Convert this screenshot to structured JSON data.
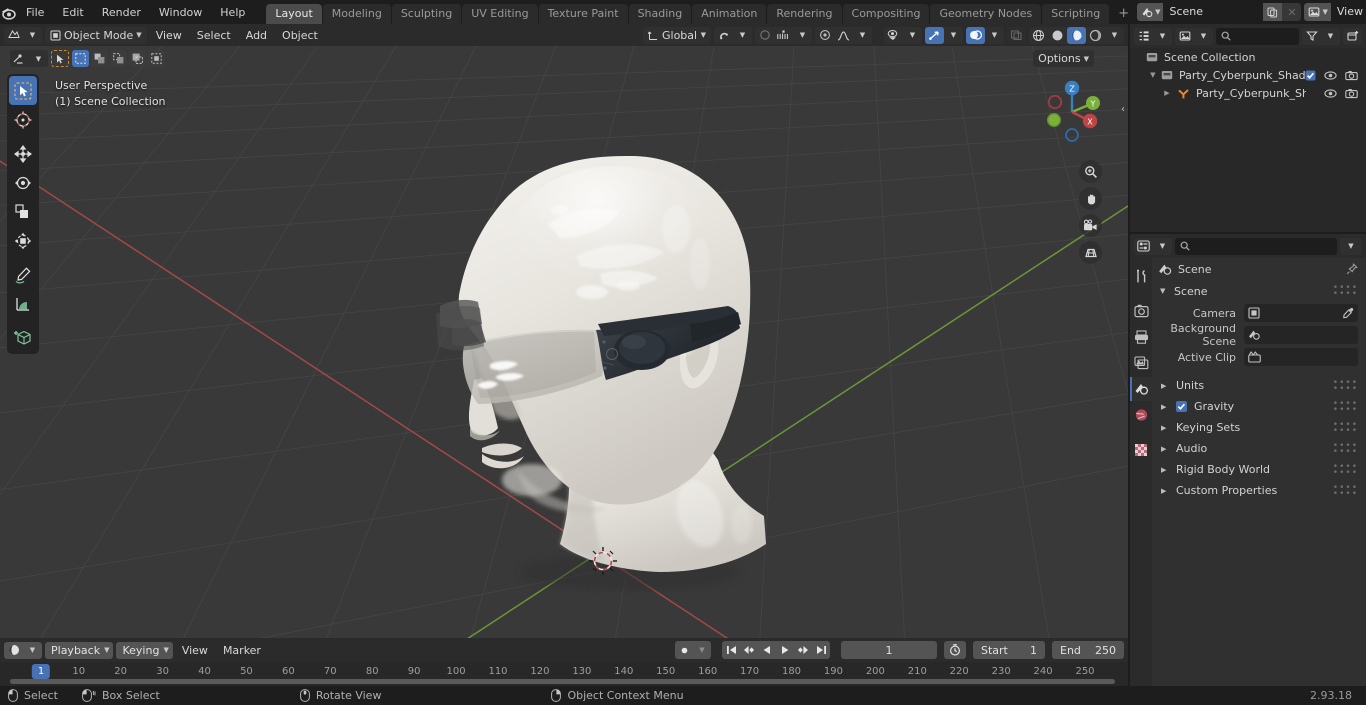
{
  "app": {
    "name": "Blender",
    "version": "2.93.18"
  },
  "topbar": {
    "menus": [
      "File",
      "Edit",
      "Render",
      "Window",
      "Help"
    ],
    "workspaces": [
      {
        "label": "Layout",
        "active": true
      },
      {
        "label": "Modeling",
        "active": false
      },
      {
        "label": "Sculpting",
        "active": false
      },
      {
        "label": "UV Editing",
        "active": false
      },
      {
        "label": "Texture Paint",
        "active": false
      },
      {
        "label": "Shading",
        "active": false
      },
      {
        "label": "Animation",
        "active": false
      },
      {
        "label": "Rendering",
        "active": false
      },
      {
        "label": "Compositing",
        "active": false
      },
      {
        "label": "Geometry Nodes",
        "active": false
      },
      {
        "label": "Scripting",
        "active": false
      }
    ],
    "add_workspace": "+",
    "scene_name": "Scene",
    "view_layer_name": "View Layer"
  },
  "viewport": {
    "mode": "Object Mode",
    "menus": [
      "View",
      "Select",
      "Add",
      "Object"
    ],
    "transform_orientation": "Global",
    "options_label": "Options",
    "overlay_perspective": "User Perspective",
    "overlay_collection": "(1) Scene Collection",
    "gizmo_axes": [
      "X",
      "Y",
      "Z"
    ],
    "tools": [
      "tweak-select-tool",
      "cursor-tool",
      "move-tool",
      "rotate-tool",
      "scale-tool",
      "transform-tool",
      "annotate-tool",
      "measure-tool",
      "add-cube-tool"
    ],
    "nav_buttons": [
      "zoom-icon",
      "pan-hand-icon",
      "camera-view-icon",
      "toggle-ortho-icon"
    ]
  },
  "outliner": {
    "search_placeholder": "",
    "rows": [
      {
        "name": "Scene Collection",
        "indent": 0,
        "icon": "collection-icon",
        "selected": false,
        "disclosure": "",
        "has_toggles": false
      },
      {
        "name": "Party_Cyberpunk_Shades_Bl",
        "indent": 1,
        "icon": "collection-icon",
        "selected": false,
        "disclosure": "▼",
        "has_toggles": true,
        "checkbox": true
      },
      {
        "name": "Party_Cyberpunk_Shade",
        "indent": 2,
        "icon": "armature-icon",
        "selected": false,
        "disclosure": "▶",
        "has_toggles": true,
        "checkbox": false
      }
    ]
  },
  "properties": {
    "search_placeholder": "",
    "tabs": [
      {
        "name": "tool-tab",
        "active": false
      },
      {
        "name": "render-tab",
        "active": false
      },
      {
        "name": "output-tab",
        "active": false
      },
      {
        "name": "view-layer-tab",
        "active": false
      },
      {
        "name": "scene-tab",
        "active": true
      },
      {
        "name": "world-tab",
        "active": false
      },
      {
        "name": "texture-tab",
        "active": false
      }
    ],
    "breadcrumb": "Scene",
    "panel_title": "Scene",
    "fields": [
      {
        "label": "Camera",
        "value": "",
        "icon": "camera-data-icon",
        "eyedropper": true
      },
      {
        "label": "Background Scene",
        "value": "",
        "icon": "scene-icon",
        "eyedropper": false
      },
      {
        "label": "Active Clip",
        "value": "",
        "icon": "clip-icon",
        "eyedropper": false
      }
    ],
    "panels": [
      {
        "label": "Units",
        "checkbox": false
      },
      {
        "label": "Gravity",
        "checkbox": true
      },
      {
        "label": "Keying Sets",
        "checkbox": false
      },
      {
        "label": "Audio",
        "checkbox": false
      },
      {
        "label": "Rigid Body World",
        "checkbox": false
      },
      {
        "label": "Custom Properties",
        "checkbox": false
      }
    ]
  },
  "timeline": {
    "menus": [
      "Playback",
      "Keying",
      "View",
      "Marker"
    ],
    "current_frame": "1",
    "start_label": "Start",
    "start_value": "1",
    "end_label": "End",
    "end_value": "250",
    "ticks": [
      10,
      20,
      30,
      40,
      50,
      60,
      70,
      80,
      90,
      100,
      110,
      120,
      130,
      140,
      150,
      160,
      170,
      180,
      190,
      200,
      210,
      220,
      230,
      240,
      250
    ],
    "playhead_frame": "1",
    "transport": [
      "jump-start-icon",
      "prev-keyframe-icon",
      "play-reverse-icon",
      "play-icon",
      "next-keyframe-icon",
      "jump-end-icon"
    ],
    "record_icon": "record-icon"
  },
  "statusbar": {
    "items": [
      {
        "icon": "mouse-left-icon",
        "label": "Select"
      },
      {
        "icon": "mouse-left-drag-icon",
        "label": "Box Select"
      },
      {
        "icon": "mouse-middle-icon",
        "label": "Rotate View"
      },
      {
        "icon": "mouse-right-icon",
        "label": "Object Context Menu"
      }
    ],
    "version": "2.93.18"
  },
  "colors": {
    "accent": "#4772b3",
    "background": "#1d1d1d",
    "panel": "#303030",
    "viewport": "#393939",
    "axis_x": "#bf4545",
    "axis_y": "#7bb03a",
    "axis_z": "#3b7ec2"
  }
}
